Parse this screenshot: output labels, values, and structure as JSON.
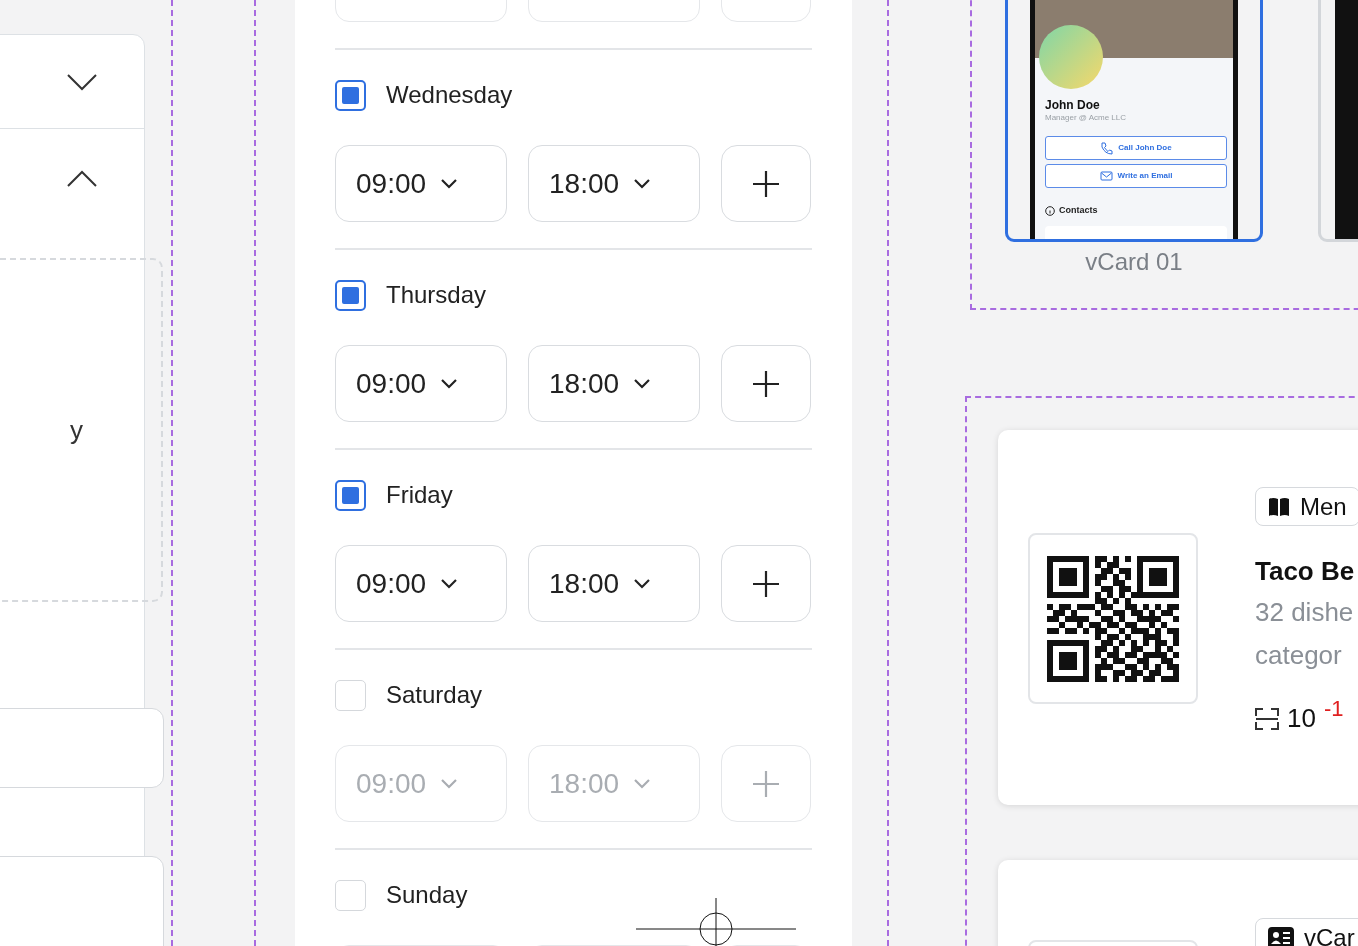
{
  "settings_panel": {
    "sections": [
      {
        "expanded": false
      },
      {
        "expanded": true
      }
    ],
    "upload_label": "y"
  },
  "schedule": {
    "days": [
      {
        "label": "Wednesday",
        "checked": true,
        "open": "09:00",
        "close": "18:00"
      },
      {
        "label": "Thursday",
        "checked": true,
        "open": "09:00",
        "close": "18:00"
      },
      {
        "label": "Friday",
        "checked": true,
        "open": "09:00",
        "close": "18:00"
      },
      {
        "label": "Saturday",
        "checked": false,
        "open": "09:00",
        "close": "18:00"
      },
      {
        "label": "Sunday",
        "checked": false
      }
    ]
  },
  "templates": [
    {
      "caption": "vCard 01",
      "selected": true,
      "name": "John Doe",
      "role": "Manager @ Acme LLC",
      "actions": [
        {
          "kind": "call",
          "label": "Call John Doe"
        },
        {
          "kind": "email",
          "label": "Write an Email"
        }
      ],
      "section": "Contacts"
    }
  ],
  "qr_cards": [
    {
      "kind": "menu",
      "badge": "Men",
      "title": "Taco Be",
      "lines": [
        "32 dishe",
        "categor"
      ],
      "count": "10",
      "change": "-1"
    },
    {
      "kind": "vcard",
      "badge": "vCar"
    }
  ]
}
